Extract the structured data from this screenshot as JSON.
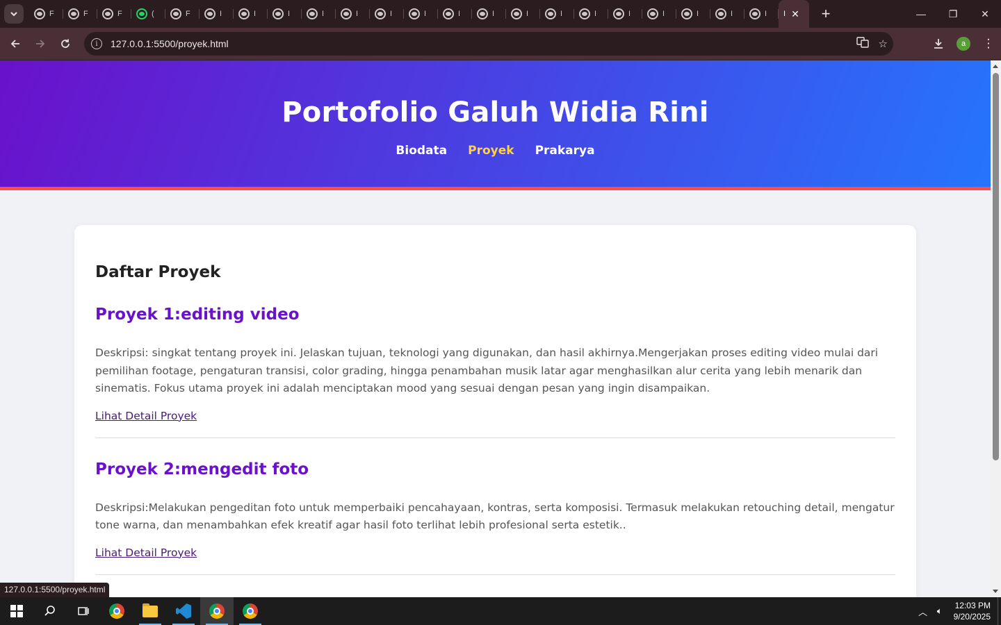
{
  "browser": {
    "tab_fragment": "F",
    "tab_fragment_alt": "(",
    "tabs": [
      {
        "icon": "globe-icon",
        "short": "F"
      },
      {
        "icon": "globe-icon",
        "short": "F"
      },
      {
        "icon": "globe-icon",
        "short": "F"
      },
      {
        "icon": "whatsapp-icon",
        "short": "("
      },
      {
        "icon": "globe-icon",
        "short": "F"
      },
      {
        "icon": "globe-icon",
        "short": "I"
      },
      {
        "icon": "globe-icon",
        "short": "I"
      },
      {
        "icon": "globe-icon",
        "short": "I"
      },
      {
        "icon": "globe-icon",
        "short": "I"
      },
      {
        "icon": "globe-icon",
        "short": "I"
      },
      {
        "icon": "globe-icon",
        "short": "I"
      },
      {
        "icon": "globe-icon",
        "short": "I"
      },
      {
        "icon": "globe-icon",
        "short": "I"
      },
      {
        "icon": "globe-icon",
        "short": "I"
      },
      {
        "icon": "globe-icon",
        "short": "I"
      },
      {
        "icon": "globe-icon",
        "short": "I"
      },
      {
        "icon": "globe-icon",
        "short": "I"
      },
      {
        "icon": "globe-icon",
        "short": "I"
      },
      {
        "icon": "globe-icon",
        "short": "I"
      },
      {
        "icon": "globe-icon",
        "short": "I"
      },
      {
        "icon": "globe-icon",
        "short": "I"
      },
      {
        "icon": "globe-icon",
        "short": "I"
      }
    ],
    "active_tab_short": "I",
    "url": "127.0.0.1:5500/proyek.html",
    "profile_initial": "a"
  },
  "site": {
    "title": "Portofolio Galuh Widia Rini",
    "nav": [
      {
        "label": "Biodata",
        "active": false
      },
      {
        "label": "Proyek",
        "active": true
      },
      {
        "label": "Prakarya",
        "active": false
      }
    ],
    "colors": {
      "nav_active": "#ffd23f",
      "heading_accent": "#6a11cb",
      "header_border": "#ff4b4b"
    }
  },
  "main": {
    "heading": "Daftar Proyek",
    "projects": [
      {
        "title": "Proyek 1:editing video",
        "description": "Deskripsi: singkat tentang proyek ini. Jelaskan tujuan, teknologi yang digunakan, dan hasil akhirnya.Mengerjakan proses editing video mulai dari pemilihan footage, pengaturan transisi, color grading, hingga penambahan musik latar agar menghasilkan alur cerita yang lebih menarik dan sinematis. Fokus utama proyek ini adalah menciptakan mood yang sesuai dengan pesan yang ingin disampaikan.",
        "link": "Lihat Detail Proyek"
      },
      {
        "title": "Proyek 2:mengedit foto",
        "description": "Deskripsi:Melakukan pengeditan foto untuk memperbaiki pencahayaan, kontras, serta komposisi. Termasuk melakukan retouching detail, mengatur tone warna, dan menambahkan efek kreatif agar hasil foto terlihat lebih profesional serta estetik..",
        "link": "Lihat Detail Proyek"
      }
    ]
  },
  "status_bar": {
    "hover_url": "127.0.0.1:5500/proyek.html"
  },
  "taskbar": {
    "time": "12:03 PM",
    "date": "9/20/2025"
  }
}
